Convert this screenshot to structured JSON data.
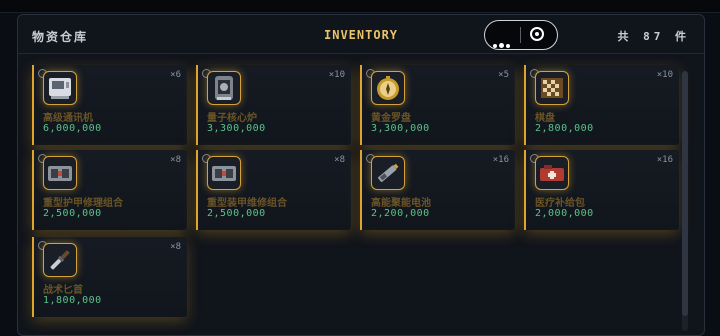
{
  "header": {
    "left_label": "物资仓库",
    "title": "INVENTORY",
    "count_label": "共 87 件"
  },
  "items": [
    {
      "name": "高级通讯机",
      "price": "6,000,000",
      "qty": "×6",
      "icon": "device-icon"
    },
    {
      "name": "量子核心炉",
      "price": "3,300,000",
      "qty": "×10",
      "icon": "reactor-icon"
    },
    {
      "name": "黄金罗盘",
      "price": "3,300,000",
      "qty": "×5",
      "icon": "compass-icon"
    },
    {
      "name": "棋盘",
      "price": "2,800,000",
      "qty": "×10",
      "icon": "chess-board-icon"
    },
    {
      "name": "重型护甲修理组合",
      "price": "2,500,000",
      "qty": "×8",
      "icon": "armor-kit-icon"
    },
    {
      "name": "重型装甲维修组合",
      "price": "2,500,000",
      "qty": "×8",
      "icon": "armor-kit-icon"
    },
    {
      "name": "高能聚能电池",
      "price": "2,200,000",
      "qty": "×16",
      "icon": "battery-icon"
    },
    {
      "name": "医疗补给包",
      "price": "2,000,000",
      "qty": "×16",
      "icon": "medkit-icon"
    },
    {
      "name": "战术匕首",
      "price": "1,800,000",
      "qty": "×8",
      "icon": "knife-icon"
    }
  ],
  "colors": {
    "accent": "#e0a42c",
    "price": "#5cc38a",
    "title": "#e8c36a"
  }
}
